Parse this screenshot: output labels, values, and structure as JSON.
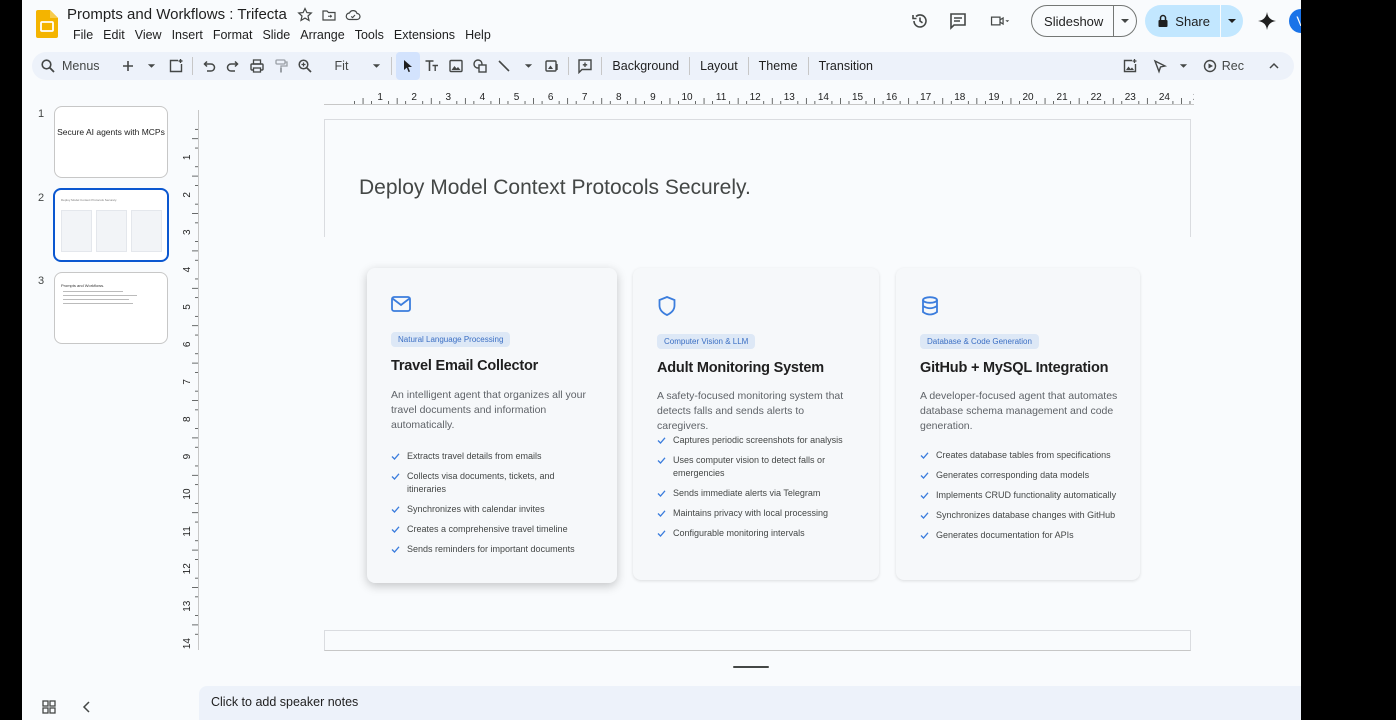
{
  "header": {
    "doc_title": "Prompts and Workflows : Trifecta",
    "menu": [
      "File",
      "Edit",
      "View",
      "Insert",
      "Format",
      "Slide",
      "Arrange",
      "Tools",
      "Extensions",
      "Help"
    ],
    "slideshow_label": "Slideshow",
    "share_label": "Share",
    "avatar_letter": "V"
  },
  "toolbar": {
    "menus_label": "Menus",
    "zoom_label": "Fit",
    "background_label": "Background",
    "layout_label": "Layout",
    "theme_label": "Theme",
    "transition_label": "Transition",
    "rec_label": "Rec"
  },
  "filmstrip": {
    "slides": [
      {
        "number": "1",
        "title": "Secure AI agents with MCPs"
      },
      {
        "number": "2",
        "title": "Deploy Model Context Protocols Securely."
      },
      {
        "number": "3",
        "title": "Prompts and Workflows."
      }
    ]
  },
  "ruler": {
    "h_numbers": [
      "1",
      "2",
      "3",
      "4",
      "5",
      "6",
      "7",
      "8",
      "9",
      "10",
      "11",
      "12",
      "13",
      "14",
      "15",
      "16",
      "17",
      "18",
      "19",
      "20",
      "21",
      "22",
      "23",
      "24",
      "25"
    ],
    "v_numbers": [
      "1",
      "2",
      "3",
      "4",
      "5",
      "6",
      "7",
      "8",
      "9",
      "10",
      "11",
      "12",
      "13",
      "14"
    ]
  },
  "slide": {
    "title": "Deploy Model Context Protocols Securely.",
    "cards": [
      {
        "icon": "mail-icon",
        "badge": "Natural Language Processing",
        "title": "Travel Email Collector",
        "description": "An intelligent agent that organizes all your travel documents and information automatically.",
        "features": [
          "Extracts travel details from emails",
          "Collects visa documents, tickets, and itineraries",
          "Synchronizes with calendar invites",
          "Creates a comprehensive travel timeline",
          "Sends reminders for important documents"
        ]
      },
      {
        "icon": "shield-icon",
        "badge": "Computer Vision & LLM",
        "title": "Adult Monitoring System",
        "description": "A safety-focused monitoring system that detects falls and sends alerts to caregivers.",
        "features": [
          "Captures periodic screenshots for analysis",
          "Uses computer vision to detect falls or emergencies",
          "Sends immediate alerts via Telegram",
          "Maintains privacy with local processing",
          "Configurable monitoring intervals"
        ]
      },
      {
        "icon": "database-icon",
        "badge": "Database & Code Generation",
        "title": "GitHub + MySQL Integration",
        "description": "A developer-focused agent that automates database schema management and code generation.",
        "features": [
          "Creates database tables from specifications",
          "Generates corresponding data models",
          "Implements CRUD functionality automatically",
          "Synchronizes database changes with GitHub",
          "Generates documentation for APIs"
        ]
      }
    ]
  },
  "notes": {
    "placeholder": "Click to add speaker notes"
  },
  "colors": {
    "accent": "#0b57d0",
    "icon_blue": "#3b7ddd",
    "share_bg": "#c2e7ff"
  }
}
